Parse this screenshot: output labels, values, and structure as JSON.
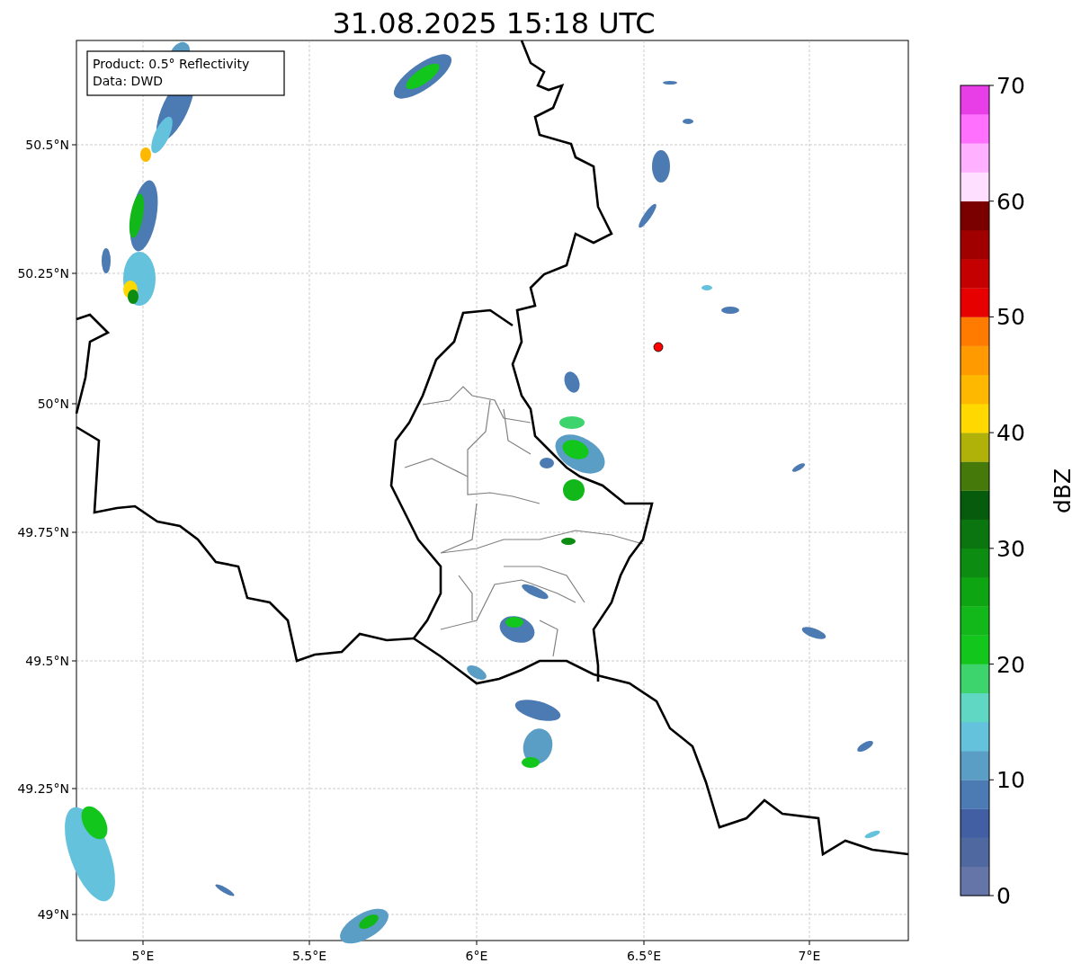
{
  "title": "31.08.2025 15:18 UTC",
  "info_box": {
    "lines": [
      "Product: 0.5° Reflectivity",
      "Data: DWD"
    ]
  },
  "x_axis": {
    "ticks": [
      "5°E",
      "5.5°E",
      "6°E",
      "6.5°E",
      "7°E"
    ]
  },
  "y_axis": {
    "ticks": [
      "50.5°N",
      "50.25°N",
      "50°N",
      "49.75°N",
      "49.5°N",
      "49.25°N",
      "49°N"
    ]
  },
  "colorbar": {
    "label": "dBZ",
    "ticks": [
      "70",
      "60",
      "50",
      "40",
      "30",
      "20",
      "10",
      "0"
    ],
    "segments": [
      {
        "color": "#6675a8"
      },
      {
        "color": "#5068a0"
      },
      {
        "color": "#425fa3"
      },
      {
        "color": "#4c7ab3"
      },
      {
        "color": "#5a9ec6"
      },
      {
        "color": "#64c2dc"
      },
      {
        "color": "#5fd7c2"
      },
      {
        "color": "#3dd46e"
      },
      {
        "color": "#12c61c"
      },
      {
        "color": "#12b81a"
      },
      {
        "color": "#0ea512"
      },
      {
        "color": "#0c8c10"
      },
      {
        "color": "#0b7610"
      },
      {
        "color": "#075b0c"
      },
      {
        "color": "#457a0b"
      },
      {
        "color": "#b0b20a"
      },
      {
        "color": "#ffd800"
      },
      {
        "color": "#ffb800"
      },
      {
        "color": "#ff9a00"
      },
      {
        "color": "#ff7b00"
      },
      {
        "color": "#e60000"
      },
      {
        "color": "#c40000"
      },
      {
        "color": "#a00000"
      },
      {
        "color": "#7a0000"
      },
      {
        "color": "#ffdfff"
      },
      {
        "color": "#ffb0ff"
      },
      {
        "color": "#ff70ff"
      },
      {
        "color": "#e83ee8"
      }
    ]
  }
}
